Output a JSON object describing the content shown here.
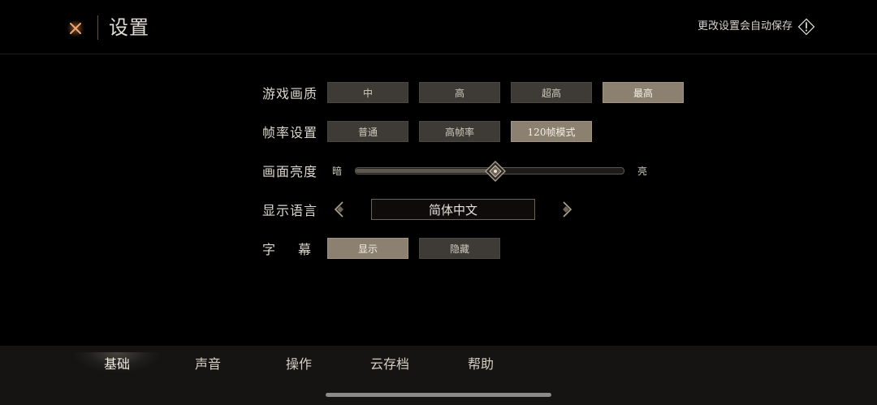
{
  "header": {
    "title": "设置",
    "autosave_notice": "更改设置会自动保存",
    "close_icon": "close-x-icon",
    "info_icon": "exclamation-diamond-icon"
  },
  "settings": {
    "quality": {
      "label": "游戏画质",
      "options": [
        "中",
        "高",
        "超高",
        "最高"
      ],
      "selected": "最高"
    },
    "framerate": {
      "label": "帧率设置",
      "options": [
        "普通",
        "高帧率",
        "120帧模式"
      ],
      "selected": "120帧模式"
    },
    "brightness": {
      "label": "画面亮度",
      "min_label": "暗",
      "max_label": "亮",
      "value_fraction": 0.52
    },
    "language": {
      "label": "显示语言",
      "value": "简体中文"
    },
    "subtitles": {
      "label": "字幕",
      "options": [
        "显示",
        "隐藏"
      ],
      "selected": "显示"
    }
  },
  "tabs": [
    {
      "label": "基础",
      "active": true
    },
    {
      "label": "声音",
      "active": false
    },
    {
      "label": "操作",
      "active": false
    },
    {
      "label": "云存档",
      "active": false
    },
    {
      "label": "帮助",
      "active": false
    }
  ],
  "colors": {
    "accent": "#e08a4c",
    "selected_option": "#8c8070",
    "option_bg": "#3e3b37"
  }
}
